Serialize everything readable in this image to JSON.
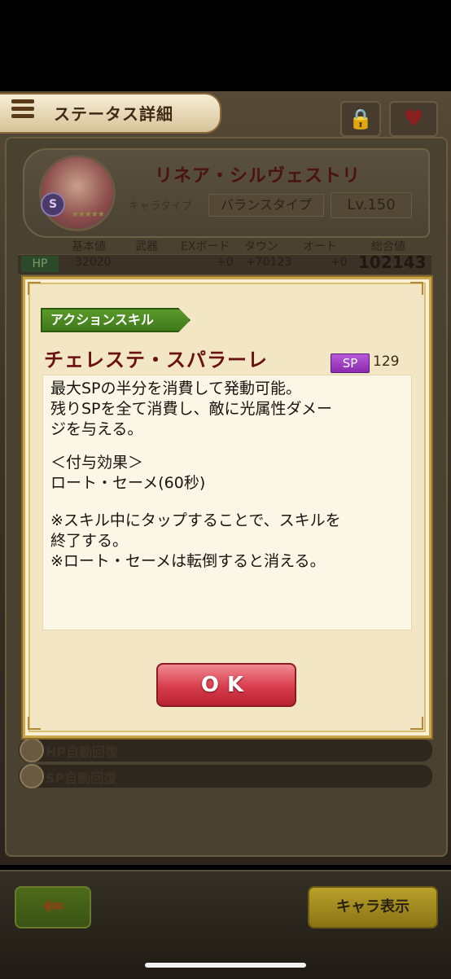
{
  "header": {
    "title": "ステータス詳細"
  },
  "character": {
    "name": "リネア・シルヴェストリ",
    "type_label": "キャラタイプ",
    "type_value": "バランスタイプ",
    "level": "Lv.150",
    "badge": "S"
  },
  "stats": {
    "columns": [
      "基本値",
      "武器",
      "EXボード",
      "タウン",
      "オート",
      "総合値"
    ],
    "hp_label": "HP",
    "hp_values": [
      "32020",
      "",
      "+0",
      "+70123",
      "+0",
      "102143"
    ]
  },
  "lower_rows": [
    {
      "label": "HP自動回復"
    },
    {
      "label": "SP自動回復"
    }
  ],
  "footer": {
    "char_button": "キャラ表示"
  },
  "dialog": {
    "tag": "アクションスキル",
    "skill_name": "チェレステ・スパラーレ",
    "sp_label": "SP",
    "sp_value": "129",
    "description_lines": [
      "最大SPの半分を消費して発動可能。",
      "残りSPを全て消費し、敵に光属性ダメー",
      "ジを与える。",
      "",
      "＜付与効果＞",
      "ロート・セーメ(60秒)",
      "",
      "※スキル中にタップすることで、スキルを",
      "終了する。",
      "※ロート・セーメは転倒すると消える。"
    ],
    "ok_label": "OK"
  }
}
